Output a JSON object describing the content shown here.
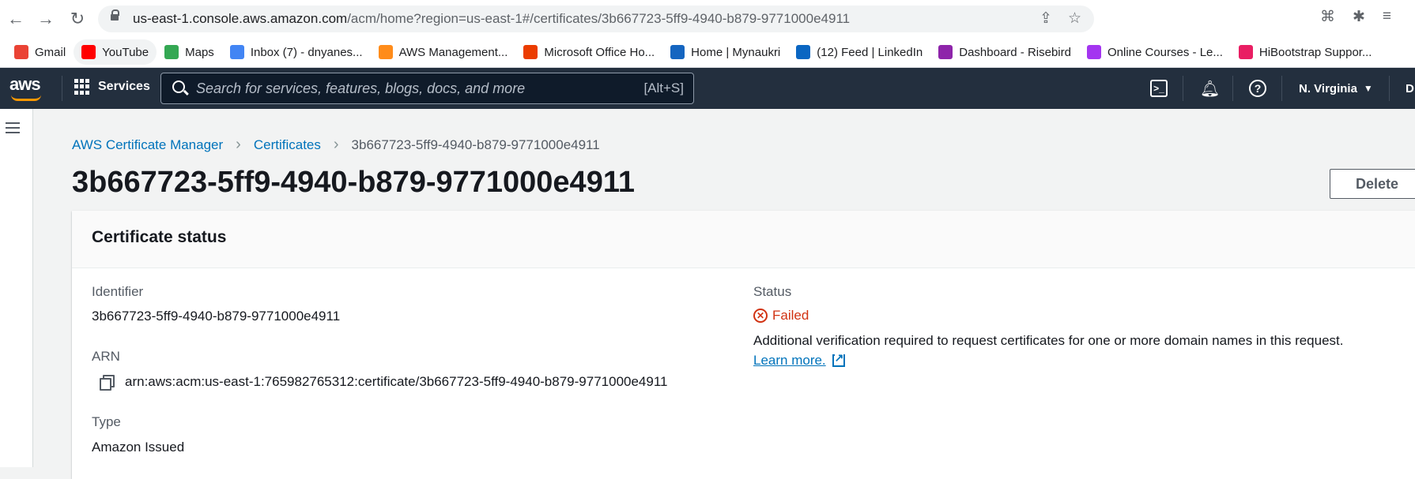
{
  "browser": {
    "url_host": "us-east-1.console.aws.amazon.com",
    "url_path": "/acm/home?region=us-east-1#/certificates/3b667723-5ff9-4940-b879-9771000e4911",
    "bookmarks": [
      {
        "label": "Gmail",
        "icon": "gmail-icon",
        "color": "#ea4335"
      },
      {
        "label": "YouTube",
        "icon": "youtube-icon",
        "color": "#ff0000"
      },
      {
        "label": "Maps",
        "icon": "maps-icon",
        "color": "#34a853"
      },
      {
        "label": "Inbox (7) - dnyanes...",
        "icon": "gmail-icon",
        "color": "#4285f4"
      },
      {
        "label": "AWS Management...",
        "icon": "aws-cube-icon",
        "color": "#ff8c1a"
      },
      {
        "label": "Microsoft Office Ho...",
        "icon": "office-icon",
        "color": "#eb3c00"
      },
      {
        "label": "Home | Mynaukri",
        "icon": "mynaukri-icon",
        "color": "#1565c0"
      },
      {
        "label": "(12) Feed | LinkedIn",
        "icon": "linkedin-icon",
        "color": "#0a66c2"
      },
      {
        "label": "Dashboard - Risebird",
        "icon": "risebird-icon",
        "color": "#8e24aa"
      },
      {
        "label": "Online Courses - Le...",
        "icon": "udemy-icon",
        "color": "#a435f0"
      },
      {
        "label": "HiBootstrap Suppor...",
        "icon": "hibootstrap-icon",
        "color": "#e91e63"
      }
    ]
  },
  "aws_nav": {
    "logo": "aws",
    "services_label": "Services",
    "search_placeholder": "Search for services, features, blogs, docs, and more",
    "search_shortcut": "[Alt+S]",
    "region": "N. Virginia",
    "account_partial": "D"
  },
  "breadcrumb": {
    "items": [
      "AWS Certificate Manager",
      "Certificates"
    ],
    "current": "3b667723-5ff9-4940-b879-9771000e4911"
  },
  "page": {
    "title": "3b667723-5ff9-4940-b879-9771000e4911",
    "delete_label": "Delete"
  },
  "cert_status": {
    "heading": "Certificate status",
    "identifier_label": "Identifier",
    "identifier_value": "3b667723-5ff9-4940-b879-9771000e4911",
    "arn_label": "ARN",
    "arn_value": "arn:aws:acm:us-east-1:765982765312:certificate/3b667723-5ff9-4940-b879-9771000e4911",
    "type_label": "Type",
    "type_value": "Amazon Issued",
    "status_label": "Status",
    "status_value": "Failed",
    "status_color": "#d13212",
    "status_message": "Additional verification required to request certificates for one or more domain names in this request.",
    "learn_more": "Learn more."
  }
}
